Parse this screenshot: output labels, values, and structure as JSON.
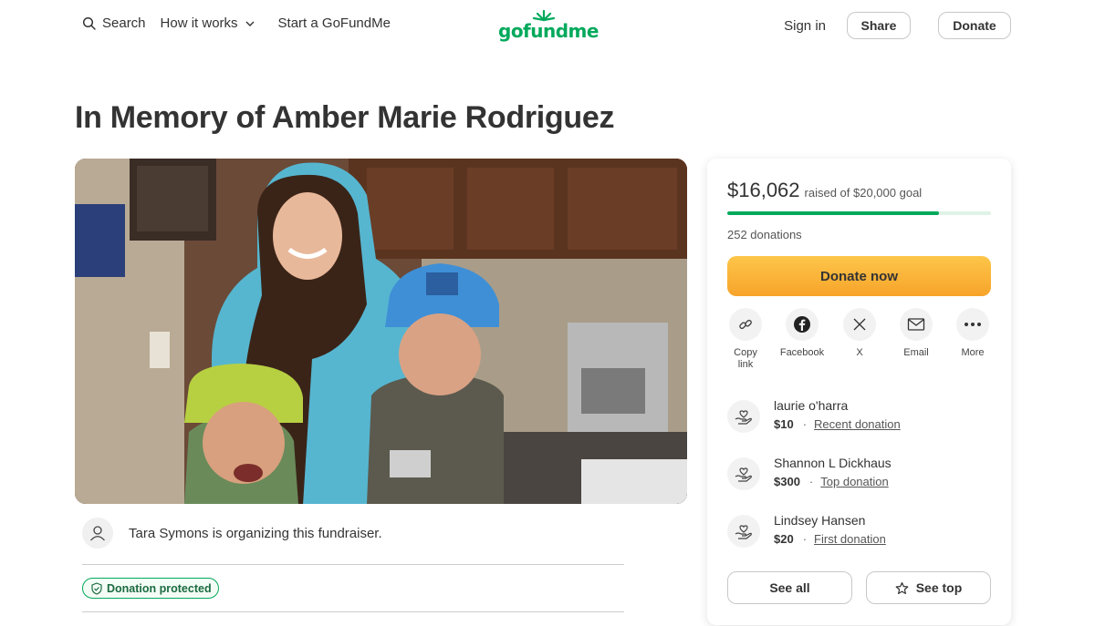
{
  "header": {
    "search_label": "Search",
    "how_it_works_label": "How it works",
    "start_label": "Start a GoFundMe",
    "logo_text": "gofundme",
    "sign_in_label": "Sign in",
    "share_label": "Share",
    "donate_label": "Donate"
  },
  "title": "In Memory of Amber Marie Rodriguez",
  "organizer": {
    "text": "Tara Symons is organizing this fundraiser."
  },
  "protected_label": "Donation protected",
  "card": {
    "raised_amount": "$16,062",
    "raised_goal": "raised of $20,000 goal",
    "progress_fraction": 0.803,
    "donations_count": "252 donations",
    "donate_now_label": "Donate now",
    "share_options": [
      {
        "label": "Copy link",
        "icon": "link-icon"
      },
      {
        "label": "Facebook",
        "icon": "facebook-icon"
      },
      {
        "label": "X",
        "icon": "x-icon"
      },
      {
        "label": "Email",
        "icon": "email-icon"
      },
      {
        "label": "More",
        "icon": "more-icon"
      }
    ],
    "donors": [
      {
        "name": "laurie o'harra",
        "amount": "$10",
        "tag": "Recent donation"
      },
      {
        "name": "Shannon L Dickhaus",
        "amount": "$300",
        "tag": "Top donation"
      },
      {
        "name": "Lindsey Hansen",
        "amount": "$20",
        "tag": "First donation"
      }
    ],
    "see_all_label": "See all",
    "see_top_label": "See top"
  },
  "colors": {
    "brand_green": "#02a95c",
    "donate_orange": "#f7a32a",
    "progress_track": "#dff3e7"
  }
}
